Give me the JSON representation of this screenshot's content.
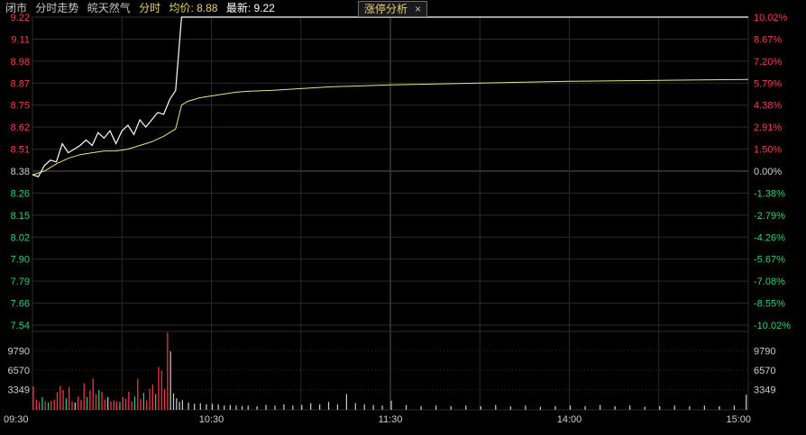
{
  "header": {
    "status": "闭市",
    "mode": "分时走势",
    "stock_name": "皖天然气",
    "period": "分时",
    "avg_label": "均价: 8.88",
    "latest_label": "最新: 9.22"
  },
  "panel_tag": {
    "label": "涨停分析",
    "close": "×"
  },
  "colors": {
    "bg": "#000000",
    "up": "#ff3b4e",
    "down": "#2fd17a",
    "flat": "#cfcfcf",
    "price_line": "#ffffff",
    "avg_line": "#e8e58a",
    "grid": "#2b2b2b",
    "grid_mid": "#3a3a3a"
  },
  "chart_data": {
    "type": "line",
    "prev_close": 8.38,
    "price_ticks": [
      "9.22",
      "9.11",
      "8.98",
      "8.87",
      "8.75",
      "8.62",
      "8.51",
      "8.38",
      "8.26",
      "8.15",
      "8.02",
      "7.90",
      "7.79",
      "7.66",
      "7.54"
    ],
    "pct_ticks": [
      "10.02%",
      "8.67%",
      "7.20%",
      "5.79%",
      "4.38%",
      "2.91%",
      "1.50%",
      "0.00%",
      "-1.38%",
      "-2.79%",
      "-4.26%",
      "-5.67%",
      "-7.08%",
      "-8.55%",
      "-10.02%"
    ],
    "ylim": [
      7.54,
      9.22
    ],
    "volume_ticks": [
      "9790",
      "6570",
      "3349"
    ],
    "volume_ylim": [
      0,
      13000
    ],
    "x_ticks": [
      "09:30",
      "10:30",
      "11:30",
      "14:00",
      "15:00"
    ],
    "total_minutes": 240,
    "series": [
      {
        "name": "价格",
        "x": [
          0,
          2,
          4,
          6,
          8,
          10,
          12,
          14,
          16,
          18,
          20,
          22,
          24,
          26,
          28,
          30,
          32,
          34,
          36,
          38,
          40,
          42,
          44,
          46,
          48,
          50,
          52,
          54,
          56,
          58,
          60,
          240
        ],
        "values": [
          8.36,
          8.35,
          8.41,
          8.44,
          8.43,
          8.53,
          8.48,
          8.5,
          8.52,
          8.55,
          8.52,
          8.59,
          8.56,
          8.6,
          8.53,
          8.6,
          8.63,
          8.58,
          8.66,
          8.62,
          8.66,
          8.7,
          8.69,
          8.77,
          8.82,
          9.22,
          9.22,
          9.22,
          9.22,
          9.22,
          9.22,
          9.22
        ]
      },
      {
        "name": "均价",
        "x": [
          0,
          4,
          8,
          12,
          16,
          20,
          24,
          28,
          32,
          36,
          40,
          44,
          48,
          50,
          52,
          56,
          60,
          64,
          68,
          72,
          80,
          100,
          120,
          150,
          180,
          210,
          240
        ],
        "values": [
          8.36,
          8.38,
          8.42,
          8.45,
          8.47,
          8.48,
          8.49,
          8.49,
          8.5,
          8.52,
          8.54,
          8.57,
          8.61,
          8.74,
          8.76,
          8.78,
          8.79,
          8.8,
          8.81,
          8.815,
          8.82,
          8.84,
          8.85,
          8.86,
          8.87,
          8.875,
          8.88
        ]
      }
    ],
    "volume": {
      "x": [
        0,
        1,
        2,
        3,
        4,
        5,
        6,
        7,
        8,
        9,
        10,
        11,
        12,
        13,
        14,
        15,
        16,
        17,
        18,
        19,
        20,
        21,
        22,
        23,
        24,
        25,
        26,
        27,
        28,
        29,
        30,
        31,
        32,
        33,
        34,
        35,
        36,
        37,
        38,
        39,
        40,
        41,
        42,
        43,
        44,
        45,
        46,
        47,
        48,
        49,
        50,
        52,
        54,
        56,
        58,
        60,
        62,
        64,
        66,
        68,
        70,
        72,
        75,
        78,
        81,
        84,
        87,
        90,
        93,
        96,
        99,
        102,
        105,
        108,
        111,
        114,
        117,
        120,
        125,
        130,
        135,
        140,
        145,
        150,
        155,
        160,
        165,
        170,
        175,
        180,
        185,
        190,
        195,
        200,
        205,
        210,
        215,
        220,
        225,
        230,
        235,
        239
      ],
      "values": [
        3900,
        1700,
        1300,
        2100,
        1400,
        1200,
        1500,
        1700,
        2900,
        4000,
        3300,
        1900,
        3800,
        1400,
        1200,
        2200,
        1600,
        4400,
        2100,
        3200,
        5200,
        2600,
        3300,
        3000,
        1700,
        2100,
        1400,
        1600,
        1400,
        1300,
        2100,
        1800,
        3000,
        1400,
        2200,
        5100,
        1800,
        2800,
        1600,
        3500,
        4200,
        2600,
        7100,
        6500,
        3400,
        12800,
        9700,
        2700,
        1900,
        1300,
        1600,
        1200,
        1000,
        1100,
        900,
        1000,
        900,
        700,
        800,
        700,
        600,
        700,
        600,
        800,
        700,
        900,
        700,
        800,
        1100,
        900,
        1300,
        900,
        2600,
        1100,
        900,
        800,
        700,
        1500,
        800,
        600,
        700,
        600,
        700,
        600,
        800,
        600,
        700,
        500,
        600,
        700,
        600,
        800,
        600,
        700,
        500,
        600,
        700,
        600,
        700,
        600,
        700,
        2500
      ],
      "colors": [
        "up",
        "up",
        "up",
        "down",
        "up",
        "down",
        "up",
        "up",
        "up",
        "up",
        "up",
        "down",
        "up",
        "up",
        "flat",
        "up",
        "up",
        "up",
        "down",
        "up",
        "up",
        "up",
        "down",
        "up",
        "up",
        "flat",
        "up",
        "up",
        "up",
        "down",
        "up",
        "up",
        "up",
        "up",
        "down",
        "up",
        "up",
        "down",
        "up",
        "up",
        "up",
        "down",
        "up",
        "up",
        "up",
        "up",
        "flat",
        "flat",
        "flat",
        "flat",
        "flat",
        "flat",
        "flat",
        "flat",
        "flat",
        "flat",
        "flat",
        "flat",
        "flat",
        "flat",
        "flat",
        "flat",
        "flat",
        "flat",
        "flat",
        "flat",
        "flat",
        "flat",
        "flat",
        "flat",
        "flat",
        "flat",
        "flat",
        "flat",
        "flat",
        "flat",
        "flat",
        "flat",
        "flat",
        "flat",
        "flat",
        "flat",
        "flat",
        "flat",
        "flat",
        "flat",
        "flat",
        "flat",
        "flat",
        "flat",
        "flat",
        "flat",
        "flat",
        "flat",
        "flat",
        "flat",
        "flat",
        "flat",
        "flat",
        "flat",
        "flat",
        "flat"
      ]
    }
  }
}
